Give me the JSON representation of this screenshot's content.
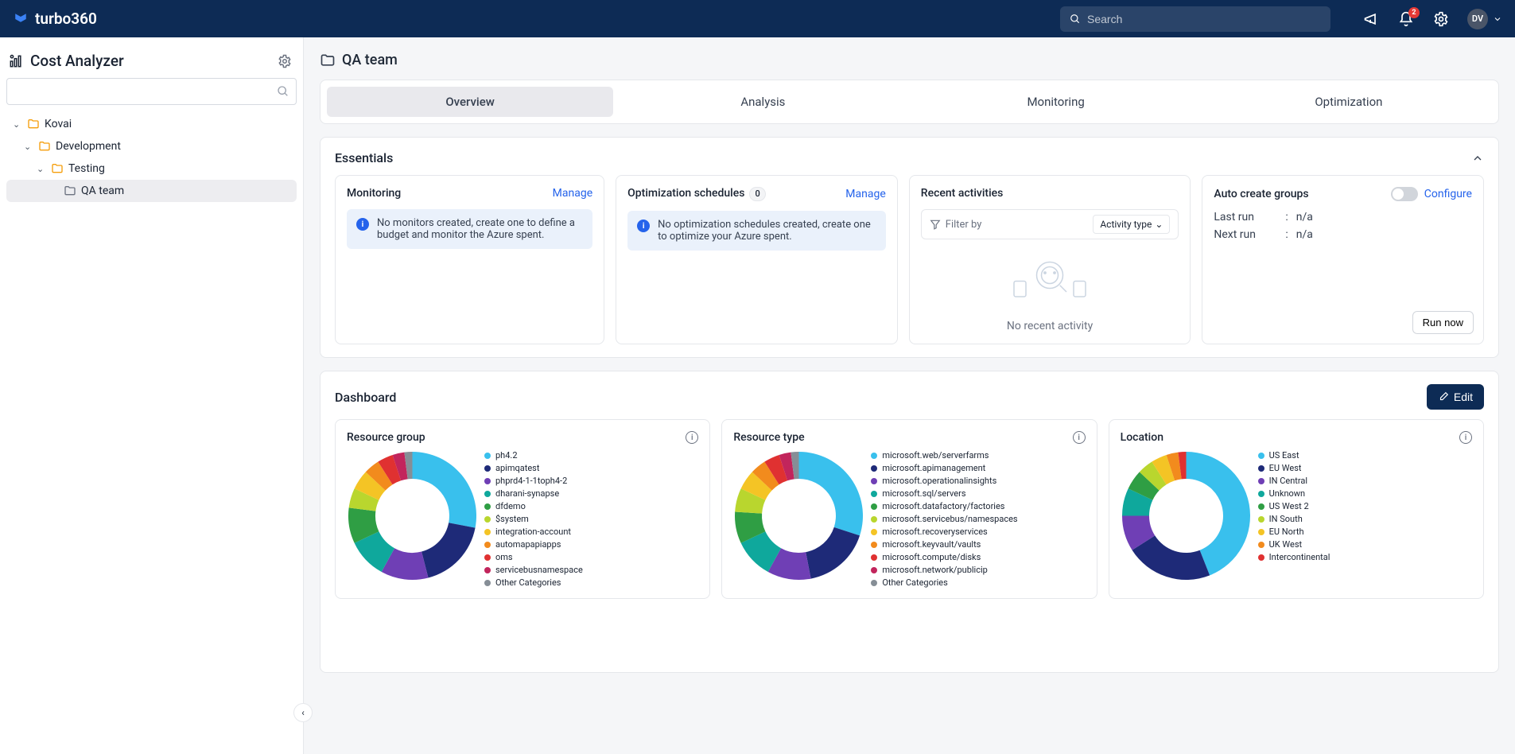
{
  "topbar": {
    "brand": "turbo360",
    "search_placeholder": "Search",
    "notification_count": "2",
    "user_initials": "DV"
  },
  "sidebar": {
    "title": "Cost Analyzer",
    "tree": {
      "root": "Kovai",
      "l2": "Development",
      "l3": "Testing",
      "l4": "QA team"
    }
  },
  "page": {
    "title": "QA team",
    "tabs": [
      "Overview",
      "Analysis",
      "Monitoring",
      "Optimization"
    ],
    "active_tab": "Overview"
  },
  "essentials": {
    "title": "Essentials",
    "monitoring": {
      "title": "Monitoring",
      "manage": "Manage",
      "message": "No monitors created, create one to define a budget and monitor the Azure spent."
    },
    "optimization": {
      "title": "Optimization schedules",
      "count": "0",
      "manage": "Manage",
      "message": "No optimization schedules created, create one to optimize your Azure spent."
    },
    "activities": {
      "title": "Recent activities",
      "filter_placeholder": "Filter by",
      "filter_select": "Activity type",
      "empty": "No recent activity"
    },
    "auto_groups": {
      "title": "Auto create groups",
      "configure": "Configure",
      "last_run_k": "Last run",
      "last_run_v": "n/a",
      "next_run_k": "Next run",
      "next_run_v": "n/a",
      "run_now": "Run now"
    }
  },
  "dashboard": {
    "title": "Dashboard",
    "edit": "Edit",
    "charts": {
      "resource_group": {
        "title": "Resource group",
        "legend": [
          "ph4.2",
          "apimqatest",
          "phprd4-1-1toph4-2",
          "dharani-synapse",
          "dfdemo",
          "$system",
          "integration-account",
          "automapapiapps",
          "oms",
          "servicebusnamespace",
          "Other Categories"
        ]
      },
      "resource_type": {
        "title": "Resource type",
        "legend": [
          "microsoft.web/serverfarms",
          "microsoft.apimanagemen...",
          "microsoft.operationalinsig...",
          "microsoft.sql/servers",
          "microsoft.datafactory/fa...",
          "microsoft.servicebus/nam...",
          "microsoft.recoveryservice...",
          "microsoft.keyvault/vaults",
          "microsoft.compute/disks",
          "microsoft.network/publici...",
          "Other Categories"
        ]
      },
      "location": {
        "title": "Location",
        "legend": [
          "US East",
          "EU West",
          "IN Central",
          "Unknown",
          "US West 2",
          "IN South",
          "EU North",
          "UK West",
          "Intercontinental"
        ]
      }
    }
  },
  "chart_data": [
    {
      "type": "pie",
      "title": "Resource group",
      "series": [
        {
          "name": "ph4.2",
          "value": 28,
          "color": "#39c0ed"
        },
        {
          "name": "apimqatest",
          "value": 18,
          "color": "#1e2a78"
        },
        {
          "name": "phprd4-1-1toph4-2",
          "value": 12,
          "color": "#6f3fb5"
        },
        {
          "name": "dharani-synapse",
          "value": 10,
          "color": "#0fa89c"
        },
        {
          "name": "dfdemo",
          "value": 9,
          "color": "#2f9e44"
        },
        {
          "name": "$system",
          "value": 5,
          "color": "#b9d62e"
        },
        {
          "name": "integration-account",
          "value": 5,
          "color": "#f4c425"
        },
        {
          "name": "automapapiapps",
          "value": 4,
          "color": "#f28b1d"
        },
        {
          "name": "oms",
          "value": 4,
          "color": "#e03131"
        },
        {
          "name": "servicebusnamespace",
          "value": 3,
          "color": "#c2255c"
        },
        {
          "name": "Other Categories",
          "value": 2,
          "color": "#868e96"
        }
      ]
    },
    {
      "type": "pie",
      "title": "Resource type",
      "series": [
        {
          "name": "microsoft.web/serverfarms",
          "value": 30,
          "color": "#39c0ed"
        },
        {
          "name": "microsoft.apimanagement",
          "value": 17,
          "color": "#1e2a78"
        },
        {
          "name": "microsoft.operationalinsights",
          "value": 11,
          "color": "#6f3fb5"
        },
        {
          "name": "microsoft.sql/servers",
          "value": 10,
          "color": "#0fa89c"
        },
        {
          "name": "microsoft.datafactory/factories",
          "value": 8,
          "color": "#2f9e44"
        },
        {
          "name": "microsoft.servicebus/namespaces",
          "value": 6,
          "color": "#b9d62e"
        },
        {
          "name": "microsoft.recoveryservices",
          "value": 5,
          "color": "#f4c425"
        },
        {
          "name": "microsoft.keyvault/vaults",
          "value": 4,
          "color": "#f28b1d"
        },
        {
          "name": "microsoft.compute/disks",
          "value": 4,
          "color": "#e03131"
        },
        {
          "name": "microsoft.network/publicip",
          "value": 3,
          "color": "#c2255c"
        },
        {
          "name": "Other Categories",
          "value": 2,
          "color": "#868e96"
        }
      ]
    },
    {
      "type": "pie",
      "title": "Location",
      "series": [
        {
          "name": "US East",
          "value": 44,
          "color": "#39c0ed"
        },
        {
          "name": "EU West",
          "value": 22,
          "color": "#1e2a78"
        },
        {
          "name": "IN Central",
          "value": 9,
          "color": "#6f3fb5"
        },
        {
          "name": "Unknown",
          "value": 7,
          "color": "#0fa89c"
        },
        {
          "name": "US West 2",
          "value": 5,
          "color": "#2f9e44"
        },
        {
          "name": "IN South",
          "value": 4,
          "color": "#b9d62e"
        },
        {
          "name": "EU North",
          "value": 4,
          "color": "#f4c425"
        },
        {
          "name": "UK West",
          "value": 3,
          "color": "#f28b1d"
        },
        {
          "name": "Intercontinental",
          "value": 2,
          "color": "#e03131"
        }
      ]
    }
  ]
}
